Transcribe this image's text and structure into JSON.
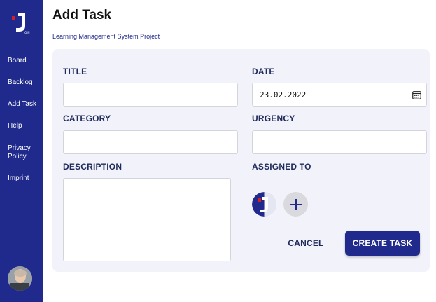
{
  "sidebar": {
    "logo_icon": "join-logo-icon",
    "items": [
      {
        "label": "Board"
      },
      {
        "label": "Backlog"
      },
      {
        "label": "Add Task"
      },
      {
        "label": "Help"
      },
      {
        "label": "Privacy Policy"
      },
      {
        "label": "Imprint"
      }
    ],
    "avatar_icon": "user-avatar"
  },
  "header": {
    "title": "Add Task",
    "project": "Learning Management System Project"
  },
  "form": {
    "title_label": "TITLE",
    "title_value": "",
    "date_label": "DATE",
    "date_value": "23.02.2022",
    "date_icon": "calendar-icon",
    "category_label": "CATEGORY",
    "category_value": "",
    "urgency_label": "URGENCY",
    "urgency_value": "",
    "description_label": "DESCRIPTION",
    "description_value": "",
    "assigned_label": "ASSIGNED TO",
    "add_assignee_icon": "plus-icon"
  },
  "actions": {
    "cancel_label": "CANCEL",
    "create_label": "CREATE TASK"
  },
  "colors": {
    "primary": "#1f2a8c",
    "card_bg": "#f2f2fa",
    "label_text": "#1f2a5a"
  }
}
